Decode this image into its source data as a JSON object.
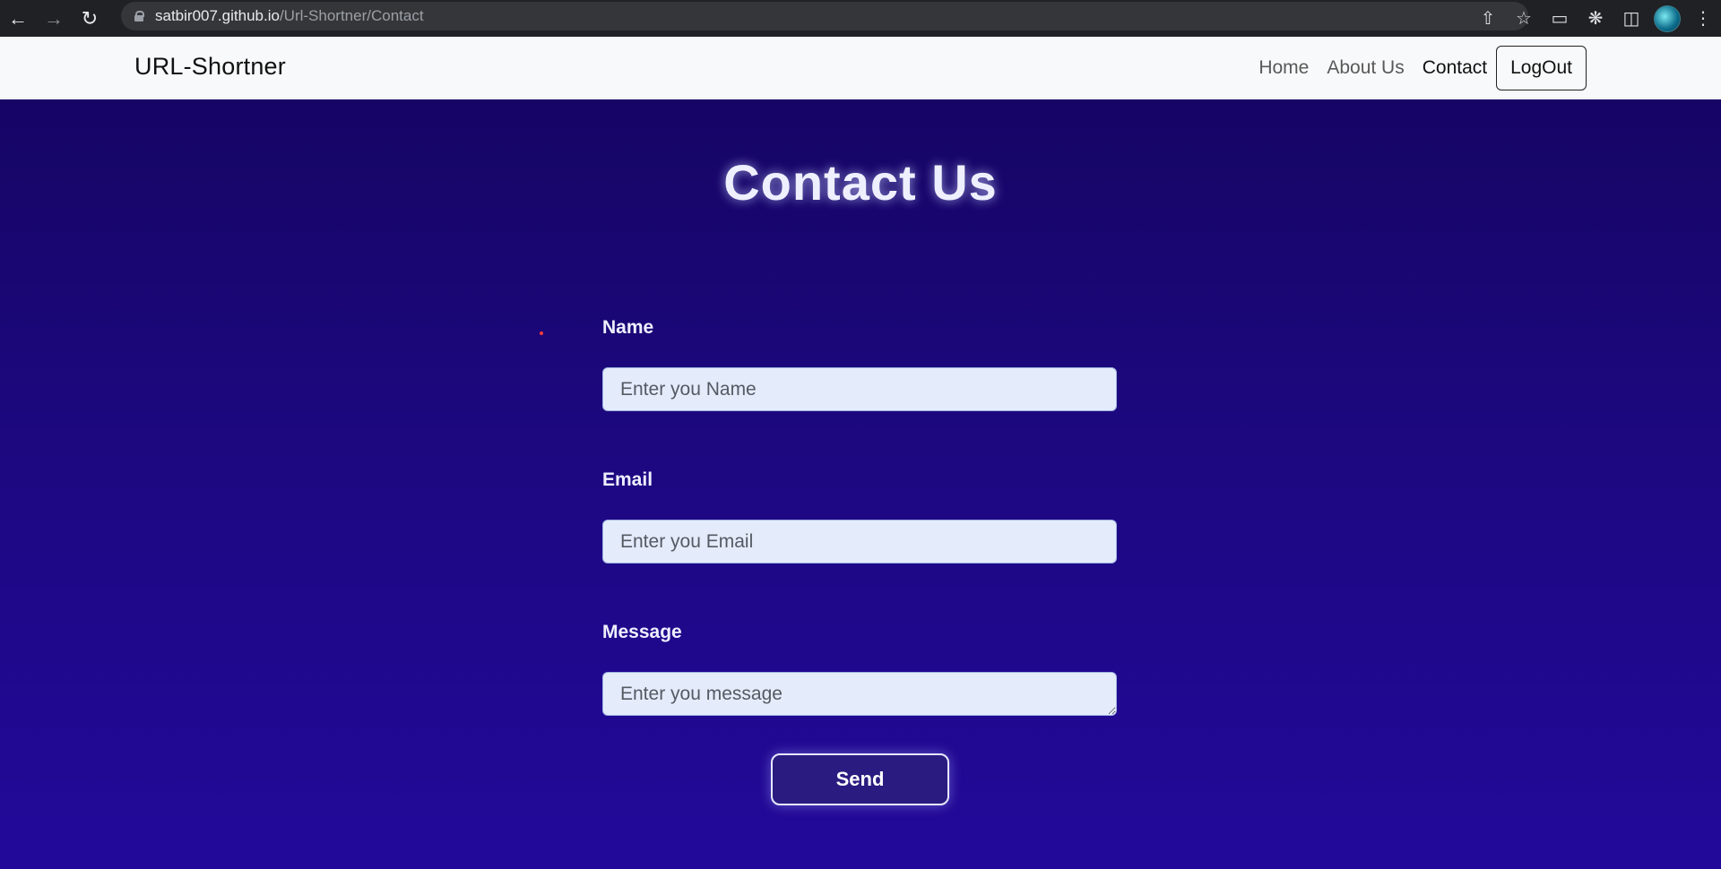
{
  "browser": {
    "url_host": "satbir007.github.io",
    "url_path": "/Url-Shortner/Contact",
    "back_icon": "arrow-left-icon",
    "forward_icon": "arrow-right-icon",
    "reload_icon": "reload-icon"
  },
  "navbar": {
    "brand": "URL-Shortner",
    "links": [
      {
        "label": "Home"
      },
      {
        "label": "About Us"
      },
      {
        "label": "Contact"
      }
    ],
    "logout_label": "LogOut"
  },
  "page": {
    "title": "Contact Us",
    "form": {
      "name_label": "Name",
      "name_placeholder": "Enter you Name",
      "email_label": "Email",
      "email_placeholder": "Enter you Email",
      "message_label": "Message",
      "message_placeholder": "Enter you message",
      "send_label": "Send"
    }
  },
  "colors": {
    "background": "#1d0880",
    "navbar": "#f8f9fa",
    "input_bg": "#e4ecfb",
    "button_bg": "#2a1b80"
  }
}
